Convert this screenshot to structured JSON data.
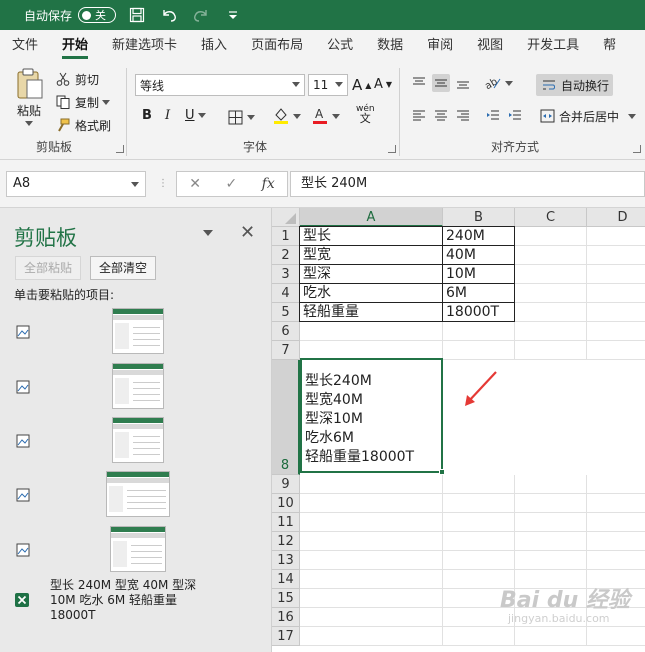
{
  "titlebar": {
    "autosave_label": "自动保存",
    "autosave_state": "关",
    "icons": [
      "save-icon",
      "undo-icon",
      "redo-icon",
      "customize-qat-icon"
    ]
  },
  "tabs": [
    "文件",
    "开始",
    "新建选项卡",
    "插入",
    "页面布局",
    "公式",
    "数据",
    "审阅",
    "视图",
    "开发工具",
    "帮"
  ],
  "active_tab": "开始",
  "ribbon": {
    "clipboard": {
      "paste": "粘贴",
      "cut": "剪切",
      "copy": "复制",
      "format_painter": "格式刷",
      "group": "剪贴板"
    },
    "font": {
      "name": "等线",
      "size": "11",
      "group": "字体",
      "bold": "B",
      "italic": "I",
      "underline": "U",
      "grow": "A",
      "shrink": "A",
      "phonetic": "wén"
    },
    "alignment": {
      "wrap": "自动换行",
      "merge": "合并后居中",
      "group": "对齐方式"
    }
  },
  "formula_bar": {
    "name_box": "A8",
    "content": "型长    240M"
  },
  "clipboard_pane": {
    "title": "剪贴板",
    "paste_all": "全部粘贴",
    "clear_all": "全部清空",
    "hint": "单击要粘贴的项目:",
    "text_item": "型长 240M 型宽 40M 型深 10M 吃水 6M 轻船重量 18000T"
  },
  "sheet": {
    "columns": [
      "A",
      "B",
      "C",
      "D"
    ],
    "rows": [
      "1",
      "2",
      "3",
      "4",
      "5",
      "6",
      "7",
      "8",
      "9",
      "10",
      "11",
      "12",
      "13",
      "14",
      "15",
      "16",
      "17"
    ],
    "data": [
      [
        "型长",
        "240M"
      ],
      [
        "型宽",
        "40M"
      ],
      [
        "型深",
        "10M"
      ],
      [
        "吃水",
        "6M"
      ],
      [
        "轻船重量",
        "18000T"
      ]
    ],
    "a8": "型长240M\n型宽40M\n型深10M\n吃水6M\n轻船重量18000T"
  },
  "watermark": {
    "brand": "Bai du 经验",
    "url": "jingyan.baidu.com"
  },
  "colors": {
    "accent": "#217346",
    "annotation_arrow": "#e53935"
  }
}
